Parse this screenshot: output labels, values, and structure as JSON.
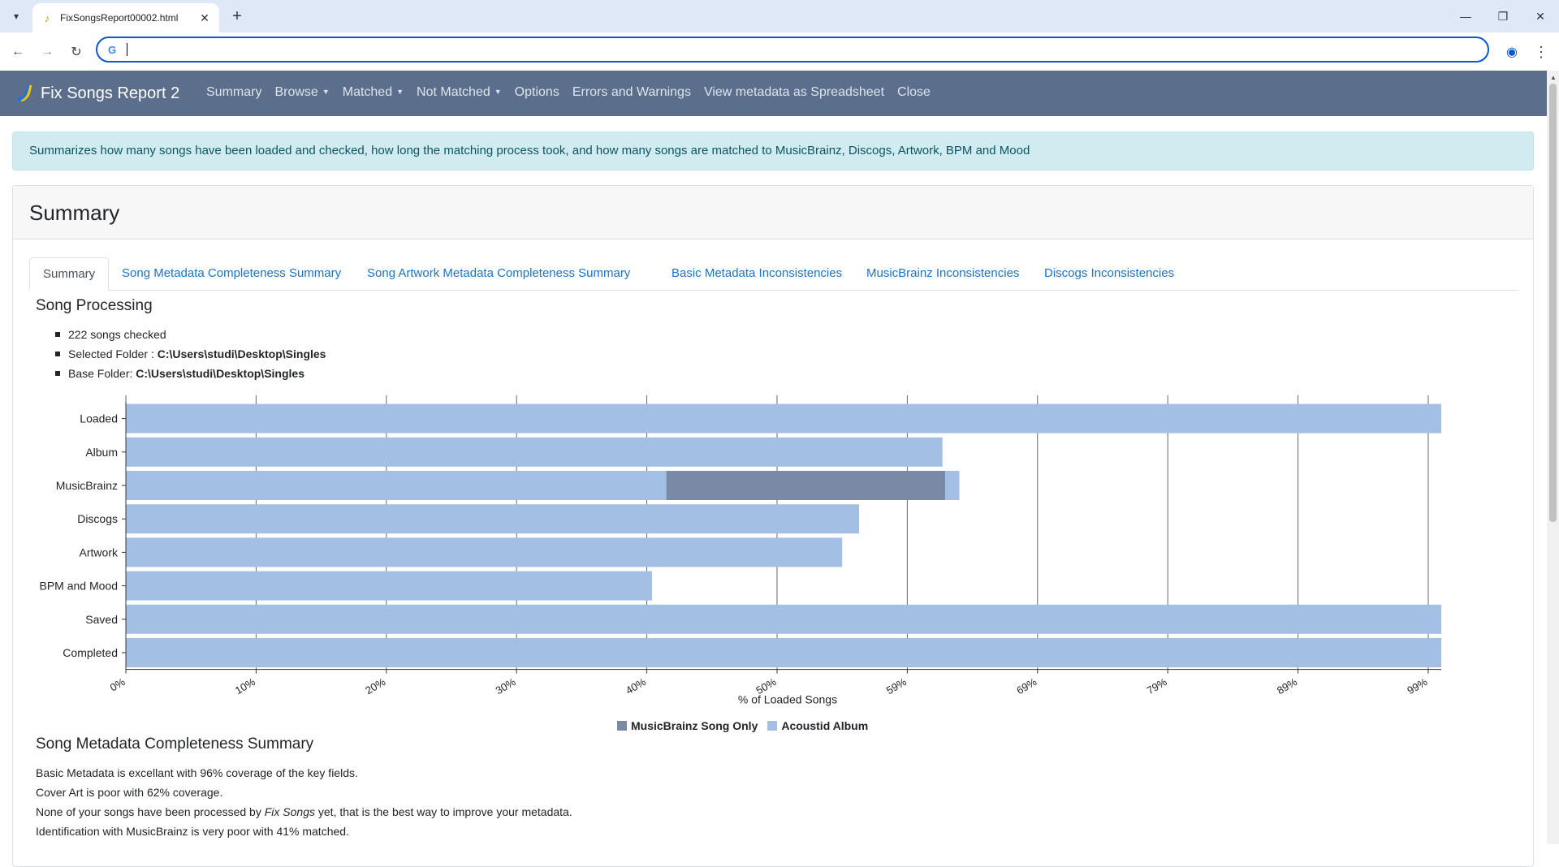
{
  "browser": {
    "tab_title": "FixSongsReport00002.html",
    "address": ""
  },
  "navbar": {
    "brand": "Fix Songs Report 2",
    "links": [
      "Summary",
      "Browse",
      "Matched",
      "Not Matched",
      "Options",
      "Errors and Warnings",
      "View metadata as Spreadsheet",
      "Close"
    ]
  },
  "info_text": "Summarizes how many songs have been loaded and checked, how long the matching process took, and how many songs are matched to MusicBrainz, Discogs, Artwork, BPM and Mood",
  "card": {
    "title": "Summary",
    "tabs": [
      "Summary",
      "Song Metadata Completeness Summary",
      "Song Artwork Metadata Completeness Summary",
      "Basic Metadata Inconsistencies",
      "MusicBrainz Inconsistencies",
      "Discogs Inconsistencies"
    ]
  },
  "processing": {
    "title": "Song Processing",
    "songs_checked": "222 songs checked",
    "selected_folder_label": "Selected Folder : ",
    "selected_folder": "C:\\Users\\studi\\Desktop\\Singles",
    "base_folder_label": "Base Folder: ",
    "base_folder": "C:\\Users\\studi\\Desktop\\Singles"
  },
  "chart_data": {
    "type": "bar",
    "orientation": "horizontal",
    "categories": [
      "Loaded",
      "Album",
      "MusicBrainz",
      "Discogs",
      "Artwork",
      "BPM and Mood",
      "Saved",
      "Completed"
    ],
    "series": [
      {
        "name": "MusicBrainz Song Only",
        "color": "#7a8aa6",
        "start": [
          null,
          null,
          41.5,
          null,
          null,
          null,
          null,
          null
        ],
        "values": [
          null,
          null,
          62.9,
          null,
          null,
          null,
          null,
          null
        ]
      },
      {
        "name": "Acoustid Album",
        "color": "#a3c0e4",
        "values": [
          101,
          62.7,
          64,
          56.3,
          55,
          40.4,
          101,
          101
        ]
      }
    ],
    "xlabel": "% of Loaded Songs",
    "xticks": [
      "0%",
      "10%",
      "20%",
      "30%",
      "40%",
      "50%",
      "59%",
      "69%",
      "79%",
      "89%",
      "99%"
    ],
    "xlim": [
      0,
      101
    ],
    "grid": true,
    "legend_position": "bottom"
  },
  "completeness": {
    "title": "Song Metadata Completeness Summary",
    "line1": "Basic Metadata is excellant with 96% coverage of the key fields.",
    "line2": "Cover Art is poor with 62% coverage.",
    "line3_pre": "None of your songs have been processed by ",
    "line3_em": "Fix Songs",
    "line3_post": " yet, that is the best way to improve your metadata.",
    "line4": "Identification with MusicBrainz is very poor with 41% matched."
  }
}
